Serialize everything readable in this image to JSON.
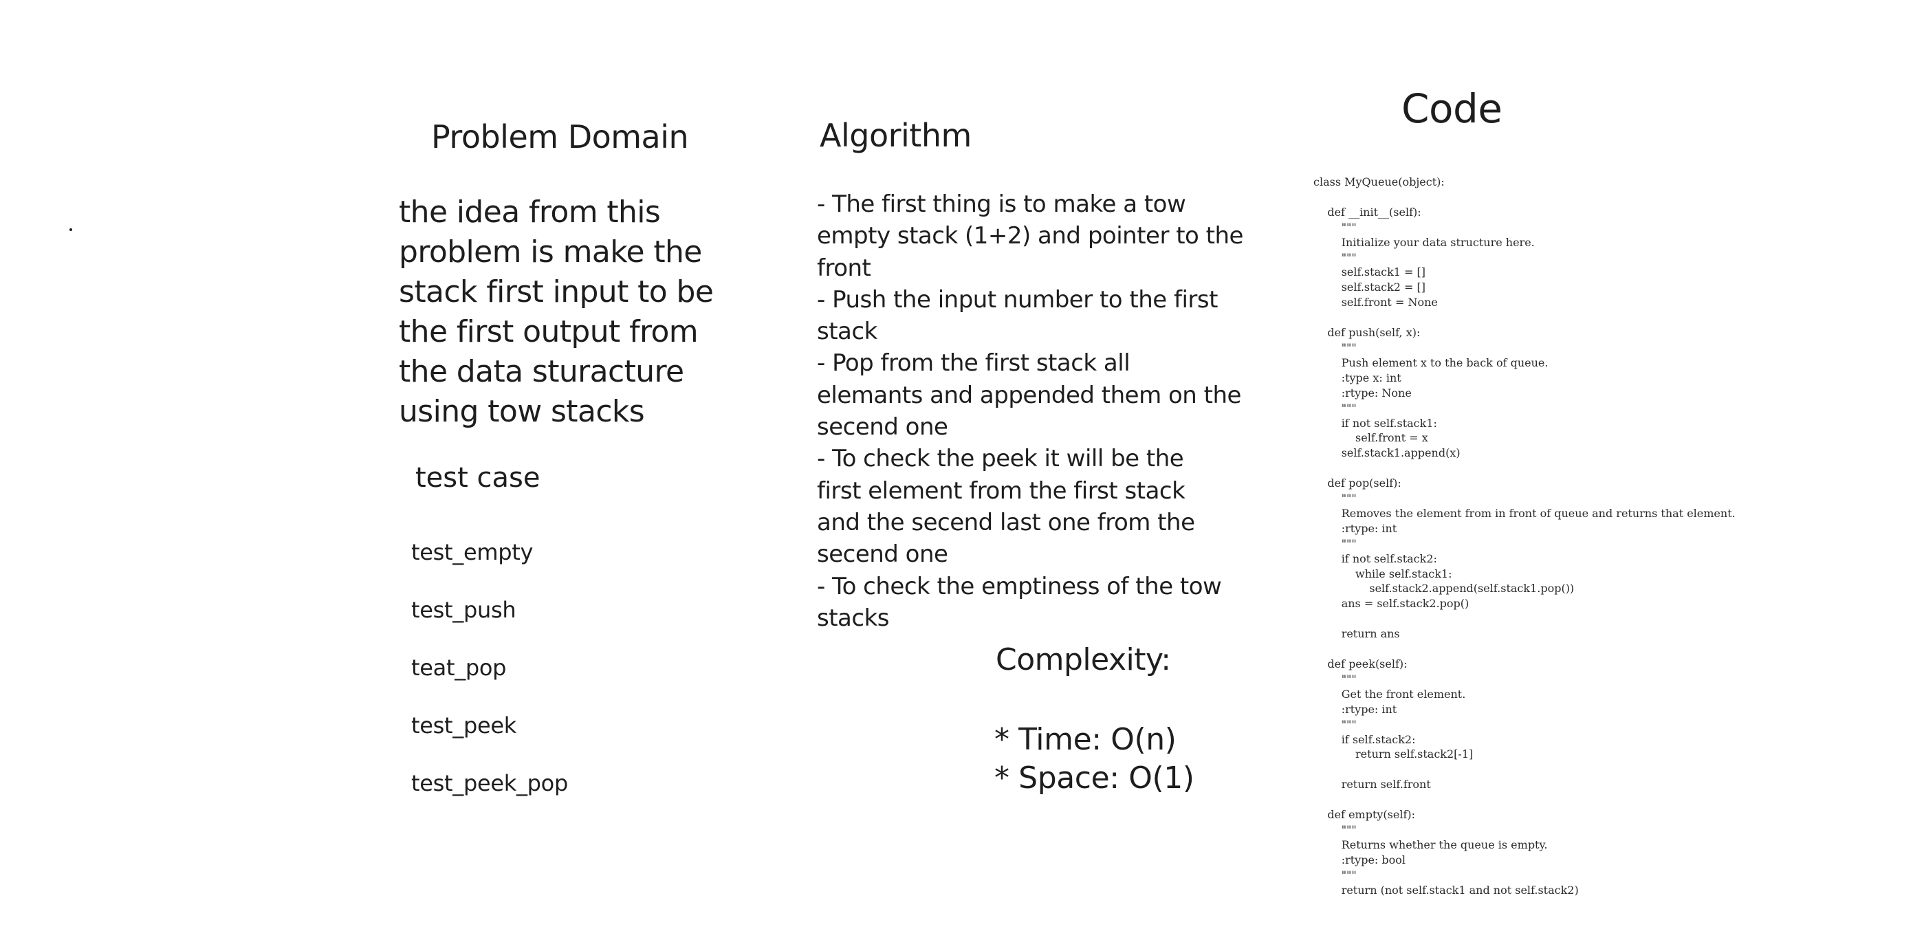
{
  "problem": {
    "title": "Problem Domain",
    "lines": [
      "the idea from this",
      "problem is make the",
      "stack first input to be",
      "the first output from",
      "the data sturacture",
      "using tow stacks"
    ]
  },
  "test_case": {
    "title": "test case",
    "items": [
      "test_empty",
      "test_push",
      "teat_pop",
      "test_peek",
      "test_peek_pop"
    ]
  },
  "algorithm": {
    "title": "Algorithm",
    "lines": [
      "- The first thing is to make a tow",
      "empty stack (1+2) and pointer to the",
      "front",
      "- Push the input number to the first",
      "stack",
      "- Pop from the first stack all",
      "elemants and appended them on the",
      "secend one",
      "- To check the peek it will be the",
      "first element from the first stack",
      "and the secend last one from the",
      "secend one",
      "- To check the emptiness of the tow",
      "stacks"
    ]
  },
  "complexity": {
    "title": "Complexity:",
    "time": "* Time: O(n)",
    "space": "* Space: O(1)"
  },
  "code": {
    "title": "Code",
    "source": "class MyQueue(object):\n\n    def __init__(self):\n        \"\"\"\n        Initialize your data structure here.\n        \"\"\"\n        self.stack1 = []\n        self.stack2 = []\n        self.front = None\n\n    def push(self, x):\n        \"\"\"\n        Push element x to the back of queue.\n        :type x: int\n        :rtype: None\n        \"\"\"\n        if not self.stack1:\n            self.front = x\n        self.stack1.append(x)\n\n    def pop(self):\n        \"\"\"\n        Removes the element from in front of queue and returns that element.\n        :rtype: int\n        \"\"\"\n        if not self.stack2:\n            while self.stack1:\n                self.stack2.append(self.stack1.pop())\n        ans = self.stack2.pop()\n\n        return ans\n\n    def peek(self):\n        \"\"\"\n        Get the front element.\n        :rtype: int\n        \"\"\"\n        if self.stack2:\n            return self.stack2[-1]\n\n        return self.front\n\n    def empty(self):\n        \"\"\"\n        Returns whether the queue is empty.\n        :rtype: bool\n        \"\"\"\n        return (not self.stack1 and not self.stack2)"
  }
}
